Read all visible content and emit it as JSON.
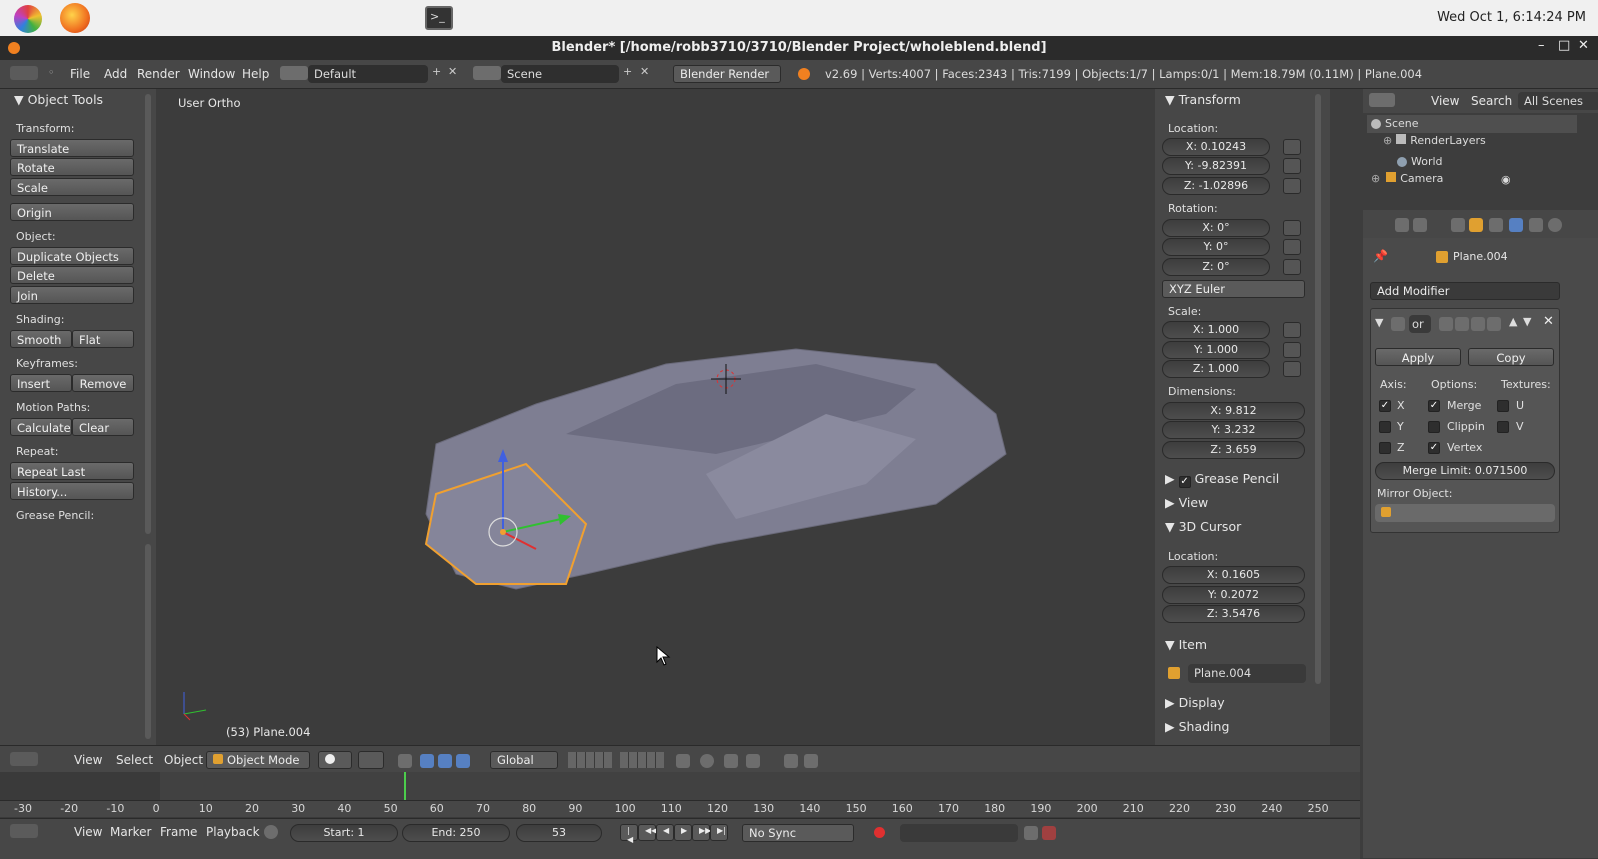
{
  "os_bar": {
    "clock": "Wed Oct  1,  6:14:24 PM"
  },
  "window": {
    "title": "Blender* [/home/robb3710/3710/Blender Project/wholeblend.blend]"
  },
  "info_header": {
    "menus": [
      "File",
      "Add",
      "Render",
      "Window",
      "Help"
    ],
    "layout": "Default",
    "scene": "Scene",
    "engine": "Blender Render",
    "stats": "v2.69 | Verts:4007 | Faces:2343 | Tris:7199 | Objects:1/7 | Lamps:0/1 | Mem:18.79M (0.11M) | Plane.004"
  },
  "toolshelf": {
    "title": "Object Tools",
    "transform_label": "Transform:",
    "translate": "Translate",
    "rotate": "Rotate",
    "scale": "Scale",
    "origin": "Origin",
    "object_label": "Object:",
    "duplicate": "Duplicate Objects",
    "delete": "Delete",
    "join": "Join",
    "shading_label": "Shading:",
    "smooth": "Smooth",
    "flat": "Flat",
    "keyframes_label": "Keyframes:",
    "insert": "Insert",
    "remove": "Remove",
    "motion_label": "Motion Paths:",
    "calculate": "Calculate",
    "clear": "Clear",
    "repeat_label": "Repeat:",
    "repeat_last": "Repeat Last",
    "history": "History...",
    "grease_label": "Grease Pencil:"
  },
  "viewport": {
    "view_name": "User Ortho",
    "object_label": "(53) Plane.004"
  },
  "npanel": {
    "transform": "Transform",
    "location": "Location:",
    "loc_x": "X: 0.10243",
    "loc_y": "Y: -9.82391",
    "loc_z": "Z: -1.02896",
    "rotation": "Rotation:",
    "rot_x": "X: 0°",
    "rot_y": "Y: 0°",
    "rot_z": "Z: 0°",
    "rot_mode": "XYZ Euler",
    "scale": "Scale:",
    "sc_x": "X: 1.000",
    "sc_y": "Y: 1.000",
    "sc_z": "Z: 1.000",
    "dimensions": "Dimensions:",
    "dim_x": "X: 9.812",
    "dim_y": "Y: 3.232",
    "dim_z": "Z: 3.659",
    "grease_pencil": "Grease Pencil",
    "view": "View",
    "cursor": "3D Cursor",
    "cursor_location": "Location:",
    "cur_x": "X: 0.1605",
    "cur_y": "Y: 0.2072",
    "cur_z": "Z: 3.5476",
    "item": "Item",
    "item_name": "Plane.004",
    "display": "Display",
    "shading": "Shading"
  },
  "outliner": {
    "menus": [
      "View",
      "Search"
    ],
    "filter": "All Scenes",
    "rows": [
      "Scene",
      "RenderLayers",
      "World",
      "Camera"
    ]
  },
  "properties": {
    "object_name": "Plane.004",
    "add_modifier": "Add Modifier",
    "mod_field": "or",
    "apply": "Apply",
    "copy": "Copy",
    "axis_label": "Axis:",
    "options_label": "Options:",
    "textures_label": "Textures:",
    "axis_x": "X",
    "axis_y": "Y",
    "axis_z": "Z",
    "merge": "Merge",
    "clipping": "Clippin",
    "vertex": "Vertex",
    "tex_u": "U",
    "tex_v": "V",
    "merge_limit": "Merge Limit: 0.071500",
    "mirror_object": "Mirror Object:"
  },
  "viewport_header": {
    "menus": [
      "View",
      "Select",
      "Object"
    ],
    "mode": "Object Mode",
    "orientation": "Global"
  },
  "timeline": {
    "ticks": [
      "-30",
      "-20",
      "-10",
      "0",
      "10",
      "20",
      "30",
      "40",
      "50",
      "60",
      "70",
      "80",
      "90",
      "100",
      "110",
      "120",
      "130",
      "140",
      "150",
      "160",
      "170",
      "180",
      "190",
      "200",
      "210",
      "220",
      "230",
      "240",
      "250"
    ],
    "current_frame_marker": 53
  },
  "timeline_header": {
    "menus": [
      "View",
      "Marker",
      "Frame",
      "Playback"
    ],
    "start": "Start: 1",
    "end": "End: 250",
    "frame": "53",
    "sync": "No Sync"
  },
  "colors": {
    "accent_blue": "#5680c2",
    "selection_orange": "#f0a030",
    "frame_green": "#4ccd4c"
  }
}
